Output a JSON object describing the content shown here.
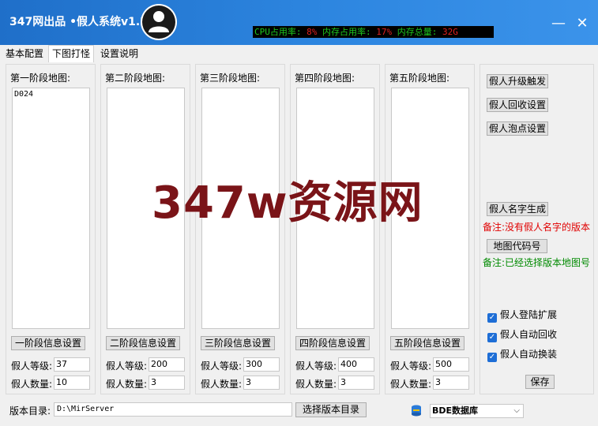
{
  "window": {
    "title": "347网出品 •假人系统v1.2",
    "stats": {
      "cpu_label": "CPU占用率:",
      "cpu_value": "8%",
      "mem_label": "内存占用率:",
      "mem_value": "17%",
      "total_label": "内存总量:",
      "total_value": "32G"
    },
    "minimize_glyph": "—",
    "close_glyph": "✕"
  },
  "tabs": [
    "基本配置",
    "下图打怪",
    "设置说明"
  ],
  "active_tab": 1,
  "stages": [
    {
      "title": "第一阶段地图:",
      "maps": "D024",
      "button": "一阶段信息设置",
      "level_label": "假人等级:",
      "level": "37",
      "count_label": "假人数量:",
      "count": "10"
    },
    {
      "title": "第二阶段地图:",
      "maps": "",
      "button": "二阶段信息设置",
      "level_label": "假人等级:",
      "level": "200",
      "count_label": "假人数量:",
      "count": "3"
    },
    {
      "title": "第三阶段地图:",
      "maps": "",
      "button": "三阶段信息设置",
      "level_label": "假人等级:",
      "level": "300",
      "count_label": "假人数量:",
      "count": "3"
    },
    {
      "title": "第四阶段地图:",
      "maps": "",
      "button": "四阶段信息设置",
      "level_label": "假人等级:",
      "level": "400",
      "count_label": "假人数量:",
      "count": "3"
    },
    {
      "title": "第五阶段地图:",
      "maps": "",
      "button": "五阶段信息设置",
      "level_label": "假人等级:",
      "level": "500",
      "count_label": "假人数量:",
      "count": "3"
    }
  ],
  "right": {
    "upgrade_btn": "假人升级触发",
    "recycle_btn": "假人回收设置",
    "idle_btn": "假人泡点设置",
    "name_btn": "假人名字生成",
    "name_note": "备注:没有假人名字的版本",
    "mapcode_btn": "地图代码号",
    "mapcode_note": "备注:已经选择版本地图号",
    "checkboxes": [
      {
        "label": "假人登陆扩展",
        "checked": true
      },
      {
        "label": "假人自动回收",
        "checked": true
      },
      {
        "label": "假人自动换装",
        "checked": true
      }
    ],
    "check_glyph": "✓",
    "save_btn": "保存",
    "colors": {
      "note_red": "#e00000",
      "note_green": "#008a00"
    }
  },
  "bottom": {
    "dir_label": "版本目录:",
    "dir_value": "D:\\MirServer",
    "dir_button": "选择版本目录",
    "db_value": "BDE数据库",
    "db_arrow": "⌵"
  },
  "watermark": "347w资源网"
}
